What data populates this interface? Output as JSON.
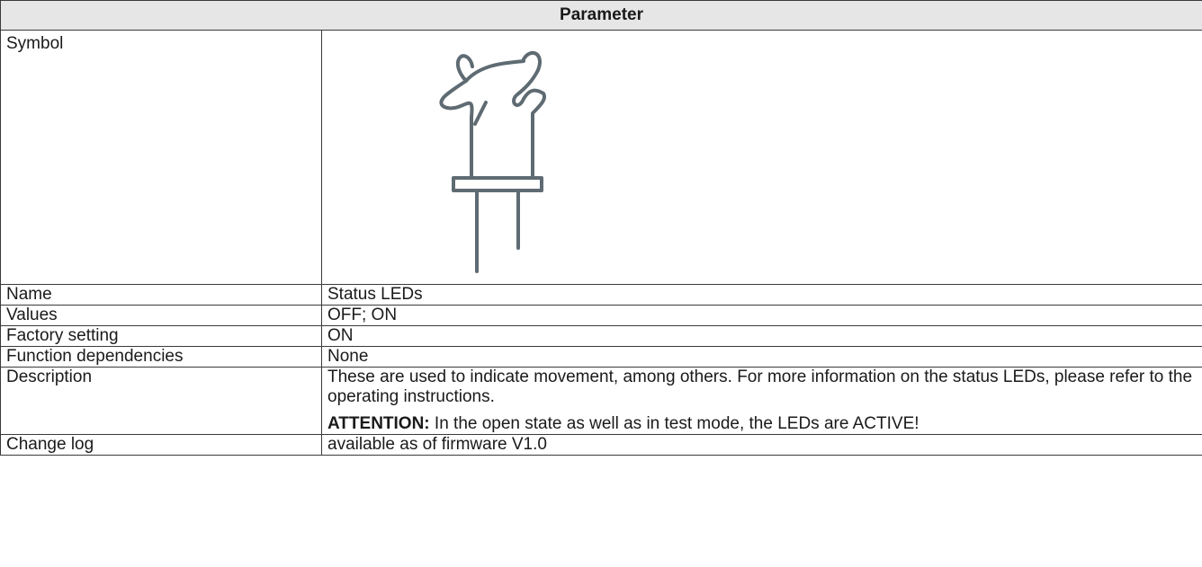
{
  "header": {
    "title": "Parameter"
  },
  "symbol": {
    "label": "Symbol",
    "icon": "led-icon",
    "icon_color": "#5f6b73"
  },
  "rows": {
    "name": {
      "label": "Name",
      "value": "Status LEDs"
    },
    "values": {
      "label": "Values",
      "value": "OFF; ON"
    },
    "factory": {
      "label": "Factory setting",
      "value": "ON"
    },
    "dependencies": {
      "label": "Function dependencies",
      "value": "None"
    },
    "description": {
      "label": "Description",
      "text": "These are used to indicate movement, among others. For more information on the status LEDs, please refer to the operating instructions.",
      "attention_label": "ATTENTION:",
      "attention_text": " In the open state as well as in test mode, the LEDs are ACTIVE!"
    },
    "changelog": {
      "label": "Change log",
      "value": "available as of firmware V1.0"
    }
  }
}
